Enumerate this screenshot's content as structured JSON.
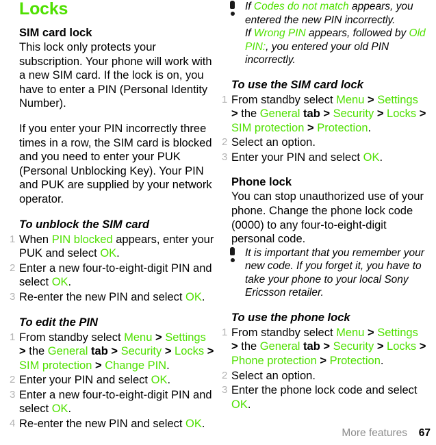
{
  "chapter": {
    "title": "Locks",
    "title_color": "#4FE000"
  },
  "left_column": {
    "section": {
      "heading": "SIM card lock",
      "paragraphs": [
        "This lock only protects your subscription. Your phone will work with a new SIM card. If the lock is on, you have to enter a PIN (Personal Identity Number).",
        "If you enter your PIN incorrectly three times in a row, the SIM card is blocked and you need to enter your PUK (Personal Unblocking Key). Your PIN and PUK are supplied by your network operator."
      ]
    },
    "proc_unblock": {
      "heading": "To unblock the SIM card",
      "steps": [
        {
          "num": "1",
          "parts": [
            {
              "t": "When ",
              "s": "plain"
            },
            {
              "t": "PIN blocked",
              "s": "green"
            },
            {
              "t": " appears, enter your PUK and select ",
              "s": "plain"
            },
            {
              "t": "OK",
              "s": "green"
            },
            {
              "t": ".",
              "s": "plain"
            }
          ]
        },
        {
          "num": "2",
          "parts": [
            {
              "t": "Enter a new four-to-eight-digit PIN and select ",
              "s": "plain"
            },
            {
              "t": "OK",
              "s": "green"
            },
            {
              "t": ".",
              "s": "plain"
            }
          ]
        },
        {
          "num": "3",
          "parts": [
            {
              "t": "Re-enter the new PIN and select ",
              "s": "plain"
            },
            {
              "t": "OK",
              "s": "green"
            },
            {
              "t": ".",
              "s": "plain"
            }
          ]
        }
      ]
    },
    "proc_edit_pin": {
      "heading": "To edit the PIN",
      "steps": [
        {
          "num": "1",
          "parts": [
            {
              "t": "From standby select ",
              "s": "plain"
            },
            {
              "t": "Menu",
              "s": "green"
            },
            {
              "t": " > ",
              "s": "sep"
            },
            {
              "t": "Settings",
              "s": "green"
            },
            {
              "t": " > ",
              "s": "sep"
            },
            {
              "t": "the ",
              "s": "plain"
            },
            {
              "t": "General",
              "s": "green"
            },
            {
              "t": " tab",
              "s": "bold"
            },
            {
              "t": " > ",
              "s": "sep"
            },
            {
              "t": "Security",
              "s": "green"
            },
            {
              "t": " > ",
              "s": "sep"
            },
            {
              "t": "Locks",
              "s": "green"
            },
            {
              "t": " > ",
              "s": "sep"
            },
            {
              "t": "SIM protection",
              "s": "green"
            },
            {
              "t": " > ",
              "s": "sep"
            },
            {
              "t": "Change PIN",
              "s": "green"
            },
            {
              "t": ".",
              "s": "plain"
            }
          ]
        },
        {
          "num": "2",
          "parts": [
            {
              "t": "Enter your PIN and select ",
              "s": "plain"
            },
            {
              "t": "OK",
              "s": "green"
            },
            {
              "t": ".",
              "s": "plain"
            }
          ]
        },
        {
          "num": "3",
          "parts": [
            {
              "t": "Enter a new four-to-eight-digit PIN and select ",
              "s": "plain"
            },
            {
              "t": "OK",
              "s": "green"
            },
            {
              "t": ".",
              "s": "plain"
            }
          ]
        },
        {
          "num": "4",
          "parts": [
            {
              "t": "Re-enter the new PIN and select ",
              "s": "plain"
            },
            {
              "t": "OK",
              "s": "green"
            },
            {
              "t": ".",
              "s": "plain"
            }
          ]
        }
      ]
    }
  },
  "right_column": {
    "note_codes": {
      "icon": "exclamation-icon",
      "parts": [
        {
          "t": "If ",
          "s": "plain"
        },
        {
          "t": "Codes do not match",
          "s": "green"
        },
        {
          "t": " appears, you entered the new PIN incorrectly.",
          "s": "plain"
        },
        {
          "t": "\n",
          "s": "break"
        },
        {
          "t": "If ",
          "s": "plain"
        },
        {
          "t": "Wrong PIN",
          "s": "green"
        },
        {
          "t": " appears, followed by ",
          "s": "plain"
        },
        {
          "t": "Old PIN:",
          "s": "green"
        },
        {
          "t": ", you entered your old PIN incorrectly.",
          "s": "plain"
        }
      ]
    },
    "proc_sim_lock": {
      "heading": "To use the SIM card lock",
      "steps": [
        {
          "num": "1",
          "parts": [
            {
              "t": "From standby select ",
              "s": "plain"
            },
            {
              "t": "Menu",
              "s": "green"
            },
            {
              "t": " > ",
              "s": "sep"
            },
            {
              "t": "Settings",
              "s": "green"
            },
            {
              "t": " > ",
              "s": "sep"
            },
            {
              "t": "the ",
              "s": "plain"
            },
            {
              "t": "General",
              "s": "green"
            },
            {
              "t": " tab",
              "s": "bold"
            },
            {
              "t": " > ",
              "s": "sep"
            },
            {
              "t": "Security",
              "s": "green"
            },
            {
              "t": " > ",
              "s": "sep"
            },
            {
              "t": "Locks",
              "s": "green"
            },
            {
              "t": " > ",
              "s": "sep"
            },
            {
              "t": "SIM protection",
              "s": "green"
            },
            {
              "t": " > ",
              "s": "sep"
            },
            {
              "t": "Protection",
              "s": "green"
            },
            {
              "t": ".",
              "s": "plain"
            }
          ]
        },
        {
          "num": "2",
          "parts": [
            {
              "t": "Select an option.",
              "s": "plain"
            }
          ]
        },
        {
          "num": "3",
          "parts": [
            {
              "t": "Enter your PIN and select ",
              "s": "plain"
            },
            {
              "t": "OK",
              "s": "green"
            },
            {
              "t": ".",
              "s": "plain"
            }
          ]
        }
      ]
    },
    "section_phone_lock": {
      "heading": "Phone lock",
      "paragraph": "You can stop unauthorized use of your phone. Change the phone lock code (0000) to any four-to-eight-digit personal code."
    },
    "note_remember": {
      "icon": "exclamation-icon",
      "text": "It is important that you remember your new code. If you forget it, you have to take your phone to your local Sony Ericsson retailer."
    },
    "proc_phone_lock": {
      "heading": "To use the phone lock",
      "steps": [
        {
          "num": "1",
          "parts": [
            {
              "t": "From standby select ",
              "s": "plain"
            },
            {
              "t": "Menu",
              "s": "green"
            },
            {
              "t": " > ",
              "s": "sep"
            },
            {
              "t": "Settings",
              "s": "green"
            },
            {
              "t": " > ",
              "s": "sep"
            },
            {
              "t": "the ",
              "s": "plain"
            },
            {
              "t": "General",
              "s": "green"
            },
            {
              "t": " tab",
              "s": "bold"
            },
            {
              "t": " > ",
              "s": "sep"
            },
            {
              "t": "Security",
              "s": "green"
            },
            {
              "t": " > ",
              "s": "sep"
            },
            {
              "t": "Locks",
              "s": "green"
            },
            {
              "t": " > ",
              "s": "sep"
            },
            {
              "t": "Phone protection",
              "s": "green"
            },
            {
              "t": " > ",
              "s": "sep"
            },
            {
              "t": "Protection",
              "s": "green"
            },
            {
              "t": ".",
              "s": "plain"
            }
          ]
        },
        {
          "num": "2",
          "parts": [
            {
              "t": "Select an option.",
              "s": "plain"
            }
          ]
        },
        {
          "num": "3",
          "parts": [
            {
              "t": "Enter the phone lock code and select ",
              "s": "plain"
            },
            {
              "t": "OK",
              "s": "green"
            },
            {
              "t": ".",
              "s": "plain"
            }
          ]
        }
      ]
    }
  },
  "footer": {
    "breadcrumb": "More features",
    "page_number": "67"
  }
}
